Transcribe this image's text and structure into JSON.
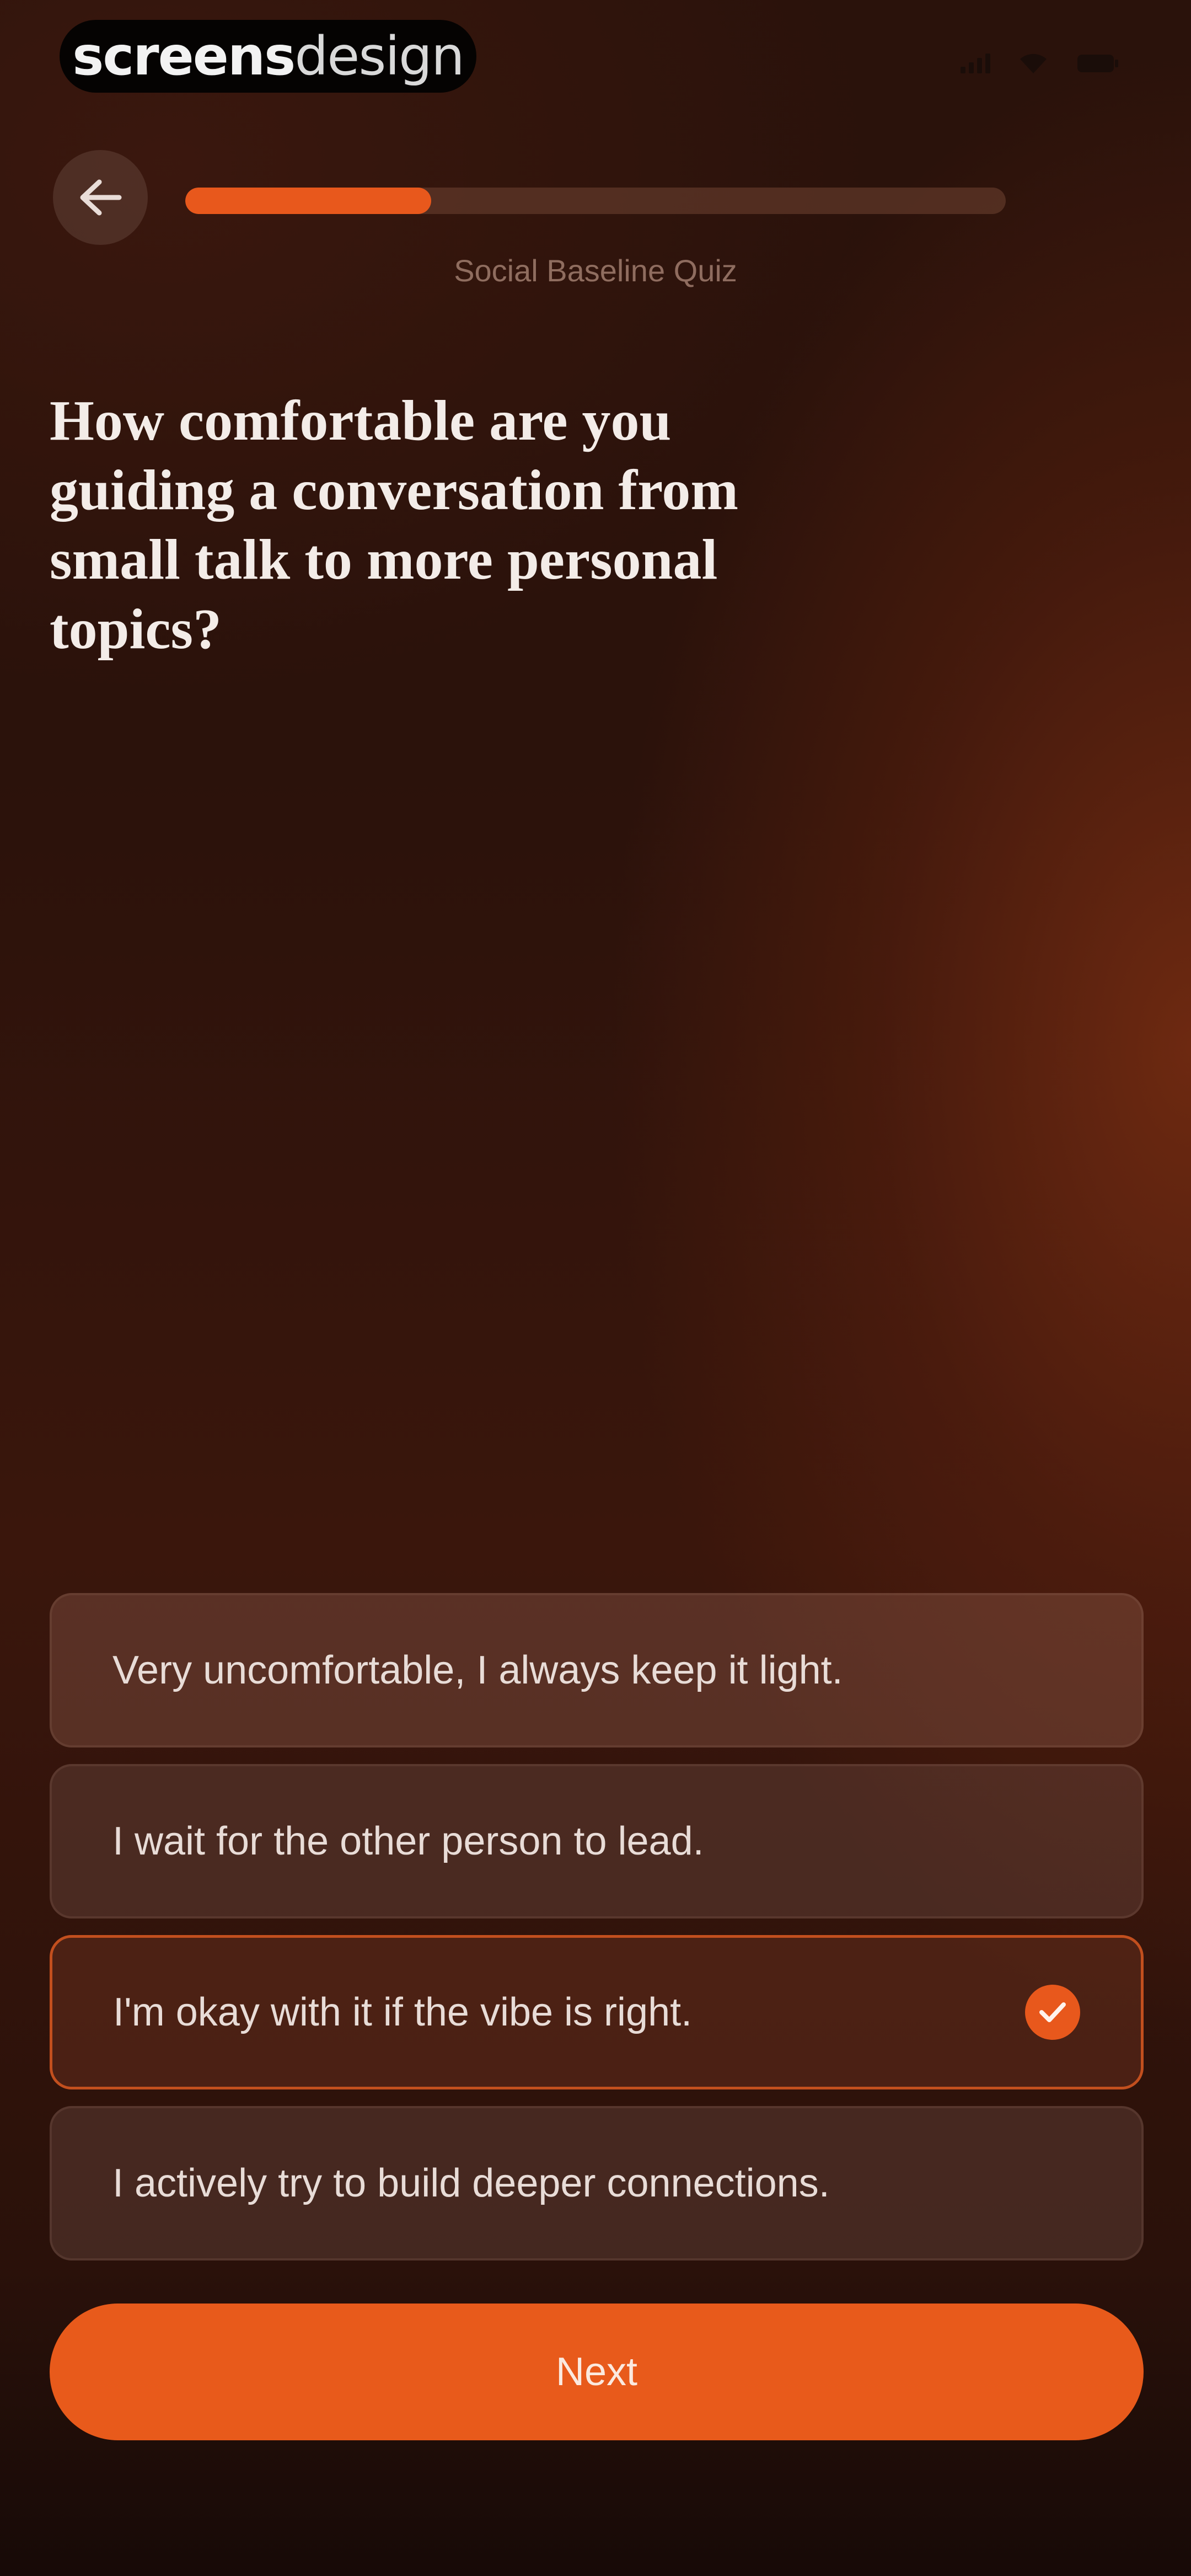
{
  "status_bar": {
    "watermark_bold": "screens",
    "watermark_light": "design"
  },
  "header": {
    "back_icon": "arrow-left-icon",
    "progress": 0.3,
    "quiz_label": "Social Baseline Quiz"
  },
  "question": {
    "text": "How comfortable are you guiding a conversation from small talk to more personal topics?"
  },
  "options": [
    {
      "label": "Very uncomfortable, I always keep it light.",
      "selected": false
    },
    {
      "label": "I wait for the other person to lead.",
      "selected": false
    },
    {
      "label": "I'm okay with it if the vibe is right.",
      "selected": true
    },
    {
      "label": "I actively try to build deeper connections.",
      "selected": false
    }
  ],
  "next_button": {
    "label": "Next"
  },
  "colors": {
    "accent": "#e8581c",
    "background": "#2a120b",
    "text": "#f3ece8"
  }
}
